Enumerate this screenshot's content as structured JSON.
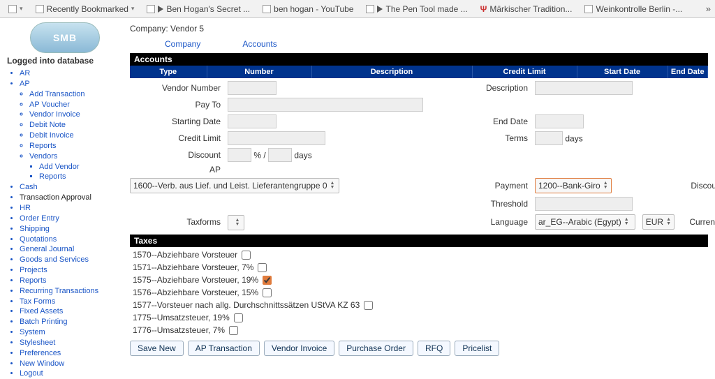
{
  "bookmarks": {
    "b0": "Recently Bookmarked",
    "b1": "Ben Hogan's Secret ...",
    "b2": "ben hogan - YouTube",
    "b3": "The Pen Tool made ...",
    "b4": "Märkischer Tradition...",
    "b5": "Weinkontrolle Berlin -...",
    "overflow": "»"
  },
  "sidebar": {
    "logo": "SMB",
    "logged": "Logged into database",
    "nav": {
      "ar": "AR",
      "ap": "AP",
      "add_tx": "Add Transaction",
      "ap_voucher": "AP Voucher",
      "vendor_inv": "Vendor Invoice",
      "debit_note": "Debit Note",
      "debit_inv": "Debit Invoice",
      "reports": "Reports",
      "vendors": "Vendors",
      "add_vendor": "Add Vendor",
      "reports2": "Reports",
      "cash": "Cash",
      "tx_approval": "Transaction Approval",
      "hr": "HR",
      "order_entry": "Order Entry",
      "shipping": "Shipping",
      "quotations": "Quotations",
      "general_journal": "General Journal",
      "goods": "Goods and Services",
      "projects": "Projects",
      "reports3": "Reports",
      "recurring": "Recurring Transactions",
      "tax_forms": "Tax Forms",
      "fixed_assets": "Fixed Assets",
      "batch": "Batch Printing",
      "system": "System",
      "stylesheet": "Stylesheet",
      "preferences": "Preferences",
      "new_window": "New Window",
      "logout": "Logout"
    }
  },
  "header": {
    "company_line": "Company:  Vendor 5",
    "tab_company": "Company",
    "tab_accounts": "Accounts"
  },
  "sections": {
    "accounts": "Accounts",
    "taxes": "Taxes"
  },
  "cols": {
    "type": "Type",
    "number": "Number",
    "desc": "Description",
    "credit": "Credit Limit",
    "start": "Start Date",
    "end": "End Date"
  },
  "labels": {
    "vendor_no": "Vendor Number",
    "pay_to": "Pay To",
    "start_date": "Starting Date",
    "credit_limit": "Credit Limit",
    "discount": "Discount",
    "ap": "AP",
    "description": "Description",
    "end_date": "End Date",
    "terms": "Terms",
    "days": "days",
    "payment": "Payment",
    "discount2": "Discount",
    "threshold": "Threshold",
    "language": "Language",
    "currency": "Currency",
    "taxforms": "Taxforms",
    "pct_days": "% /             days"
  },
  "selects": {
    "ap": "1600--Verb. aus Lief. und Leist. Lieferantengruppe 0",
    "payment": "1200--Bank-Giro",
    "language": "ar_EG--Arabic (Egypt)",
    "currency": "EUR"
  },
  "taxes": {
    "t0": "1570--Abziehbare Vorsteuer",
    "t1": "1571--Abziehbare Vorsteuer, 7%",
    "t2": "1575--Abziehbare Vorsteuer, 19%",
    "t3": "1576--Abziehbare Vorsteuer, 15%",
    "t4": "1577--Vorsteuer nach allg. Durchschnittssätzen UStVA KZ 63",
    "t5": "1775--Umsatzsteuer, 19%",
    "t6": "1776--Umsatzsteuer, 7%"
  },
  "buttons": {
    "save_new": "Save New",
    "ap_tx": "AP Transaction",
    "vendor_inv": "Vendor Invoice",
    "po": "Purchase Order",
    "rfq": "RFQ",
    "pricelist": "Pricelist"
  }
}
